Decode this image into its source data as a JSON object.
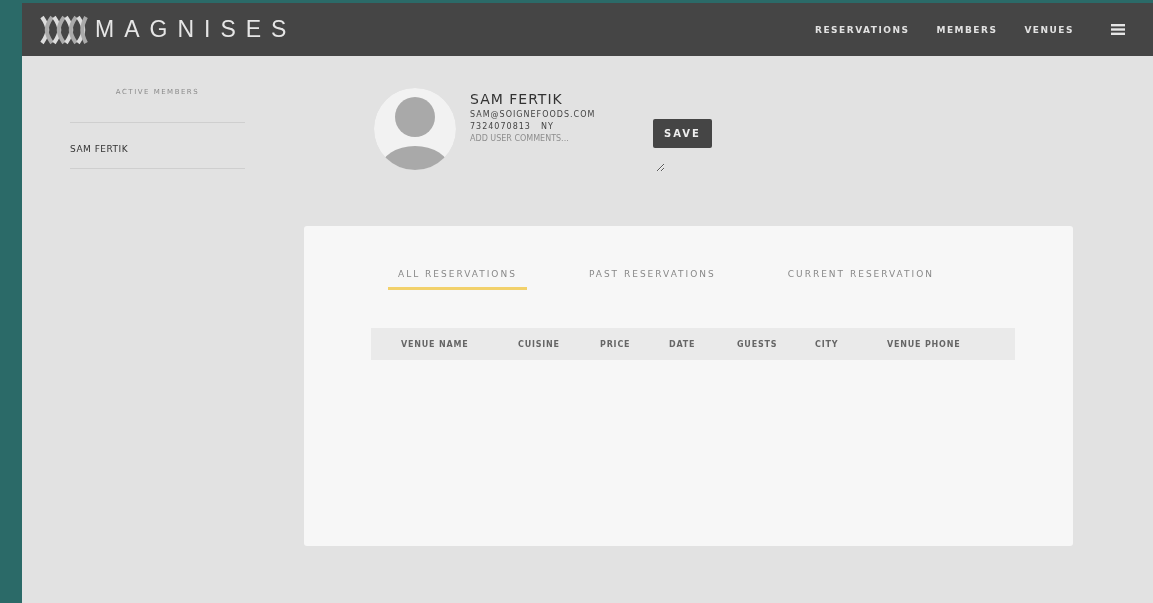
{
  "header": {
    "logo": "MAGNISES",
    "nav": [
      "RESERVATIONS",
      "MEMBERS",
      "VENUES"
    ]
  },
  "sidebar": {
    "title": "ACTIVE MEMBERS",
    "items": [
      {
        "label": "SAM FERTIK"
      }
    ]
  },
  "profile": {
    "name": "SAM FERTIK",
    "email": "SAM@SOIGNEFOODS.COM",
    "phone": "7324070813",
    "state": "NY",
    "comments": {
      "placeholder": "ADD USER COMMENTS..."
    },
    "save": "SAVE"
  },
  "tabs": [
    {
      "label": "ALL RESERVATIONS",
      "selected": true
    },
    {
      "label": "PAST RESERVATIONS",
      "selected": false
    },
    {
      "label": "CURRENT RESERVATION",
      "selected": false
    }
  ],
  "table": {
    "columns": [
      "VENUE NAME",
      "CUISINE",
      "PRICE",
      "DATE",
      "GUESTS",
      "CITY",
      "VENUE PHONE"
    ]
  }
}
